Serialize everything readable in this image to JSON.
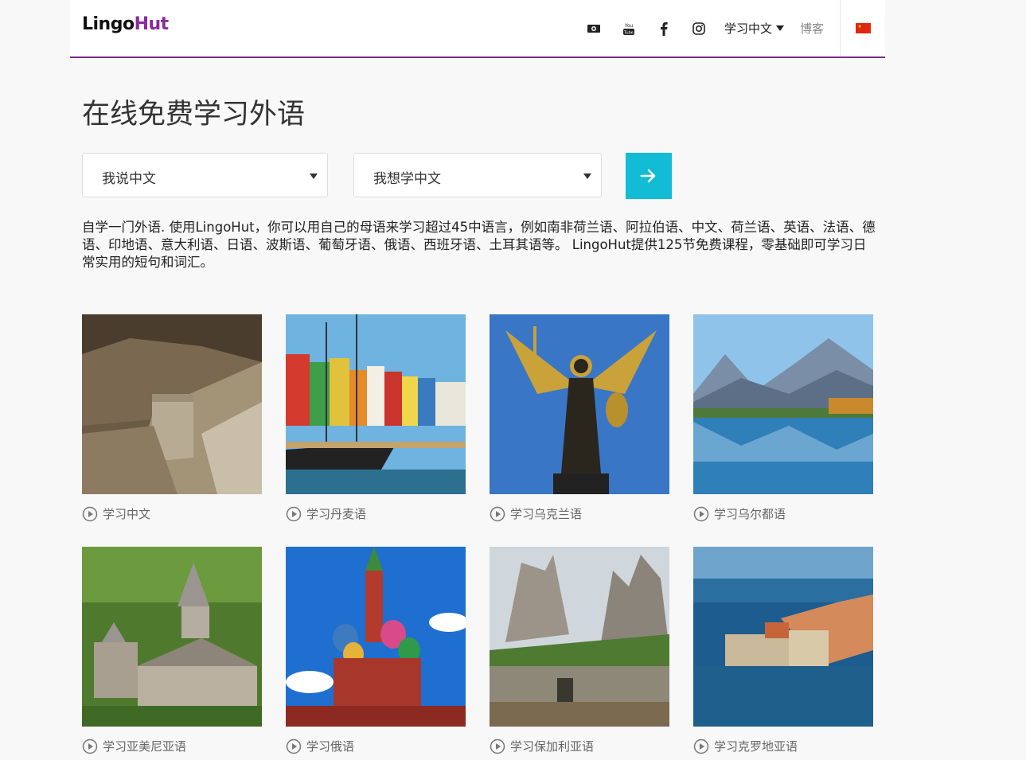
{
  "header": {
    "logo_part1": "Lingo",
    "logo_part2": "Hut",
    "icons": [
      "video-icon",
      "youtube-icon",
      "facebook-icon",
      "instagram-icon"
    ],
    "language_menu": "学习中文",
    "blog": "博客",
    "flag": "china-flag-icon"
  },
  "main": {
    "title": "在线免费学习外语",
    "speak_select": "我说中文",
    "learn_select": "我想学中文",
    "intro": "自学一门外语. 使用LingoHut，你可以用自己的母语来学习超过45中语言，例如南非荷兰语、阿拉伯语、中文、荷兰语、英语、法语、德语、印地语、意大利语、日语、波斯语、葡萄牙语、俄语、西班牙语、土耳其语等。 LingoHut提供125节免费课程，零基础即可学习日常实用的短句和词汇。"
  },
  "cards": [
    {
      "label": "学习中文"
    },
    {
      "label": "学习丹麦语"
    },
    {
      "label": "学习乌克兰语"
    },
    {
      "label": "学习乌尔都语"
    },
    {
      "label": "学习亚美尼亚语"
    },
    {
      "label": "学习俄语"
    },
    {
      "label": "学习保加利亚语"
    },
    {
      "label": "学习克罗地亚语"
    }
  ],
  "colors": {
    "accent": "#11bcd4",
    "brand_purple": "#8a2a9b",
    "header_border": "#7b2d8e"
  }
}
